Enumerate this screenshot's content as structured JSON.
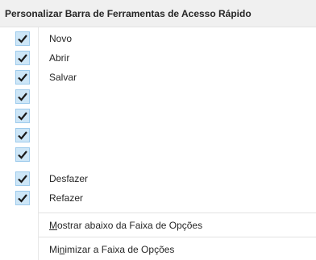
{
  "menu": {
    "title": "Personalizar Barra de Ferramentas de Acesso Rápido",
    "checked_items": [
      {
        "label": "Novo",
        "checked": true
      },
      {
        "label": "Abrir",
        "checked": true
      },
      {
        "label": "Salvar",
        "checked": true
      },
      {
        "label": "",
        "checked": true
      },
      {
        "label": "",
        "checked": true
      },
      {
        "label": "",
        "checked": true
      },
      {
        "label": "",
        "checked": true
      },
      {
        "label": "Desfazer",
        "checked": true
      },
      {
        "label": "Refazer",
        "checked": true
      }
    ],
    "show_below": {
      "label_pre": "",
      "label_key": "M",
      "label_post": "ostrar abaixo da Faixa de Opções"
    },
    "minimize": {
      "label_pre": "Mi",
      "label_key": "n",
      "label_post": "imizar a Faixa de Opções"
    }
  },
  "colors": {
    "check_bg": "#cde6f7",
    "check_border": "#9ecbec",
    "check_mark": "#1a1a1a"
  },
  "icons": {
    "check": "checkmark-icon"
  }
}
